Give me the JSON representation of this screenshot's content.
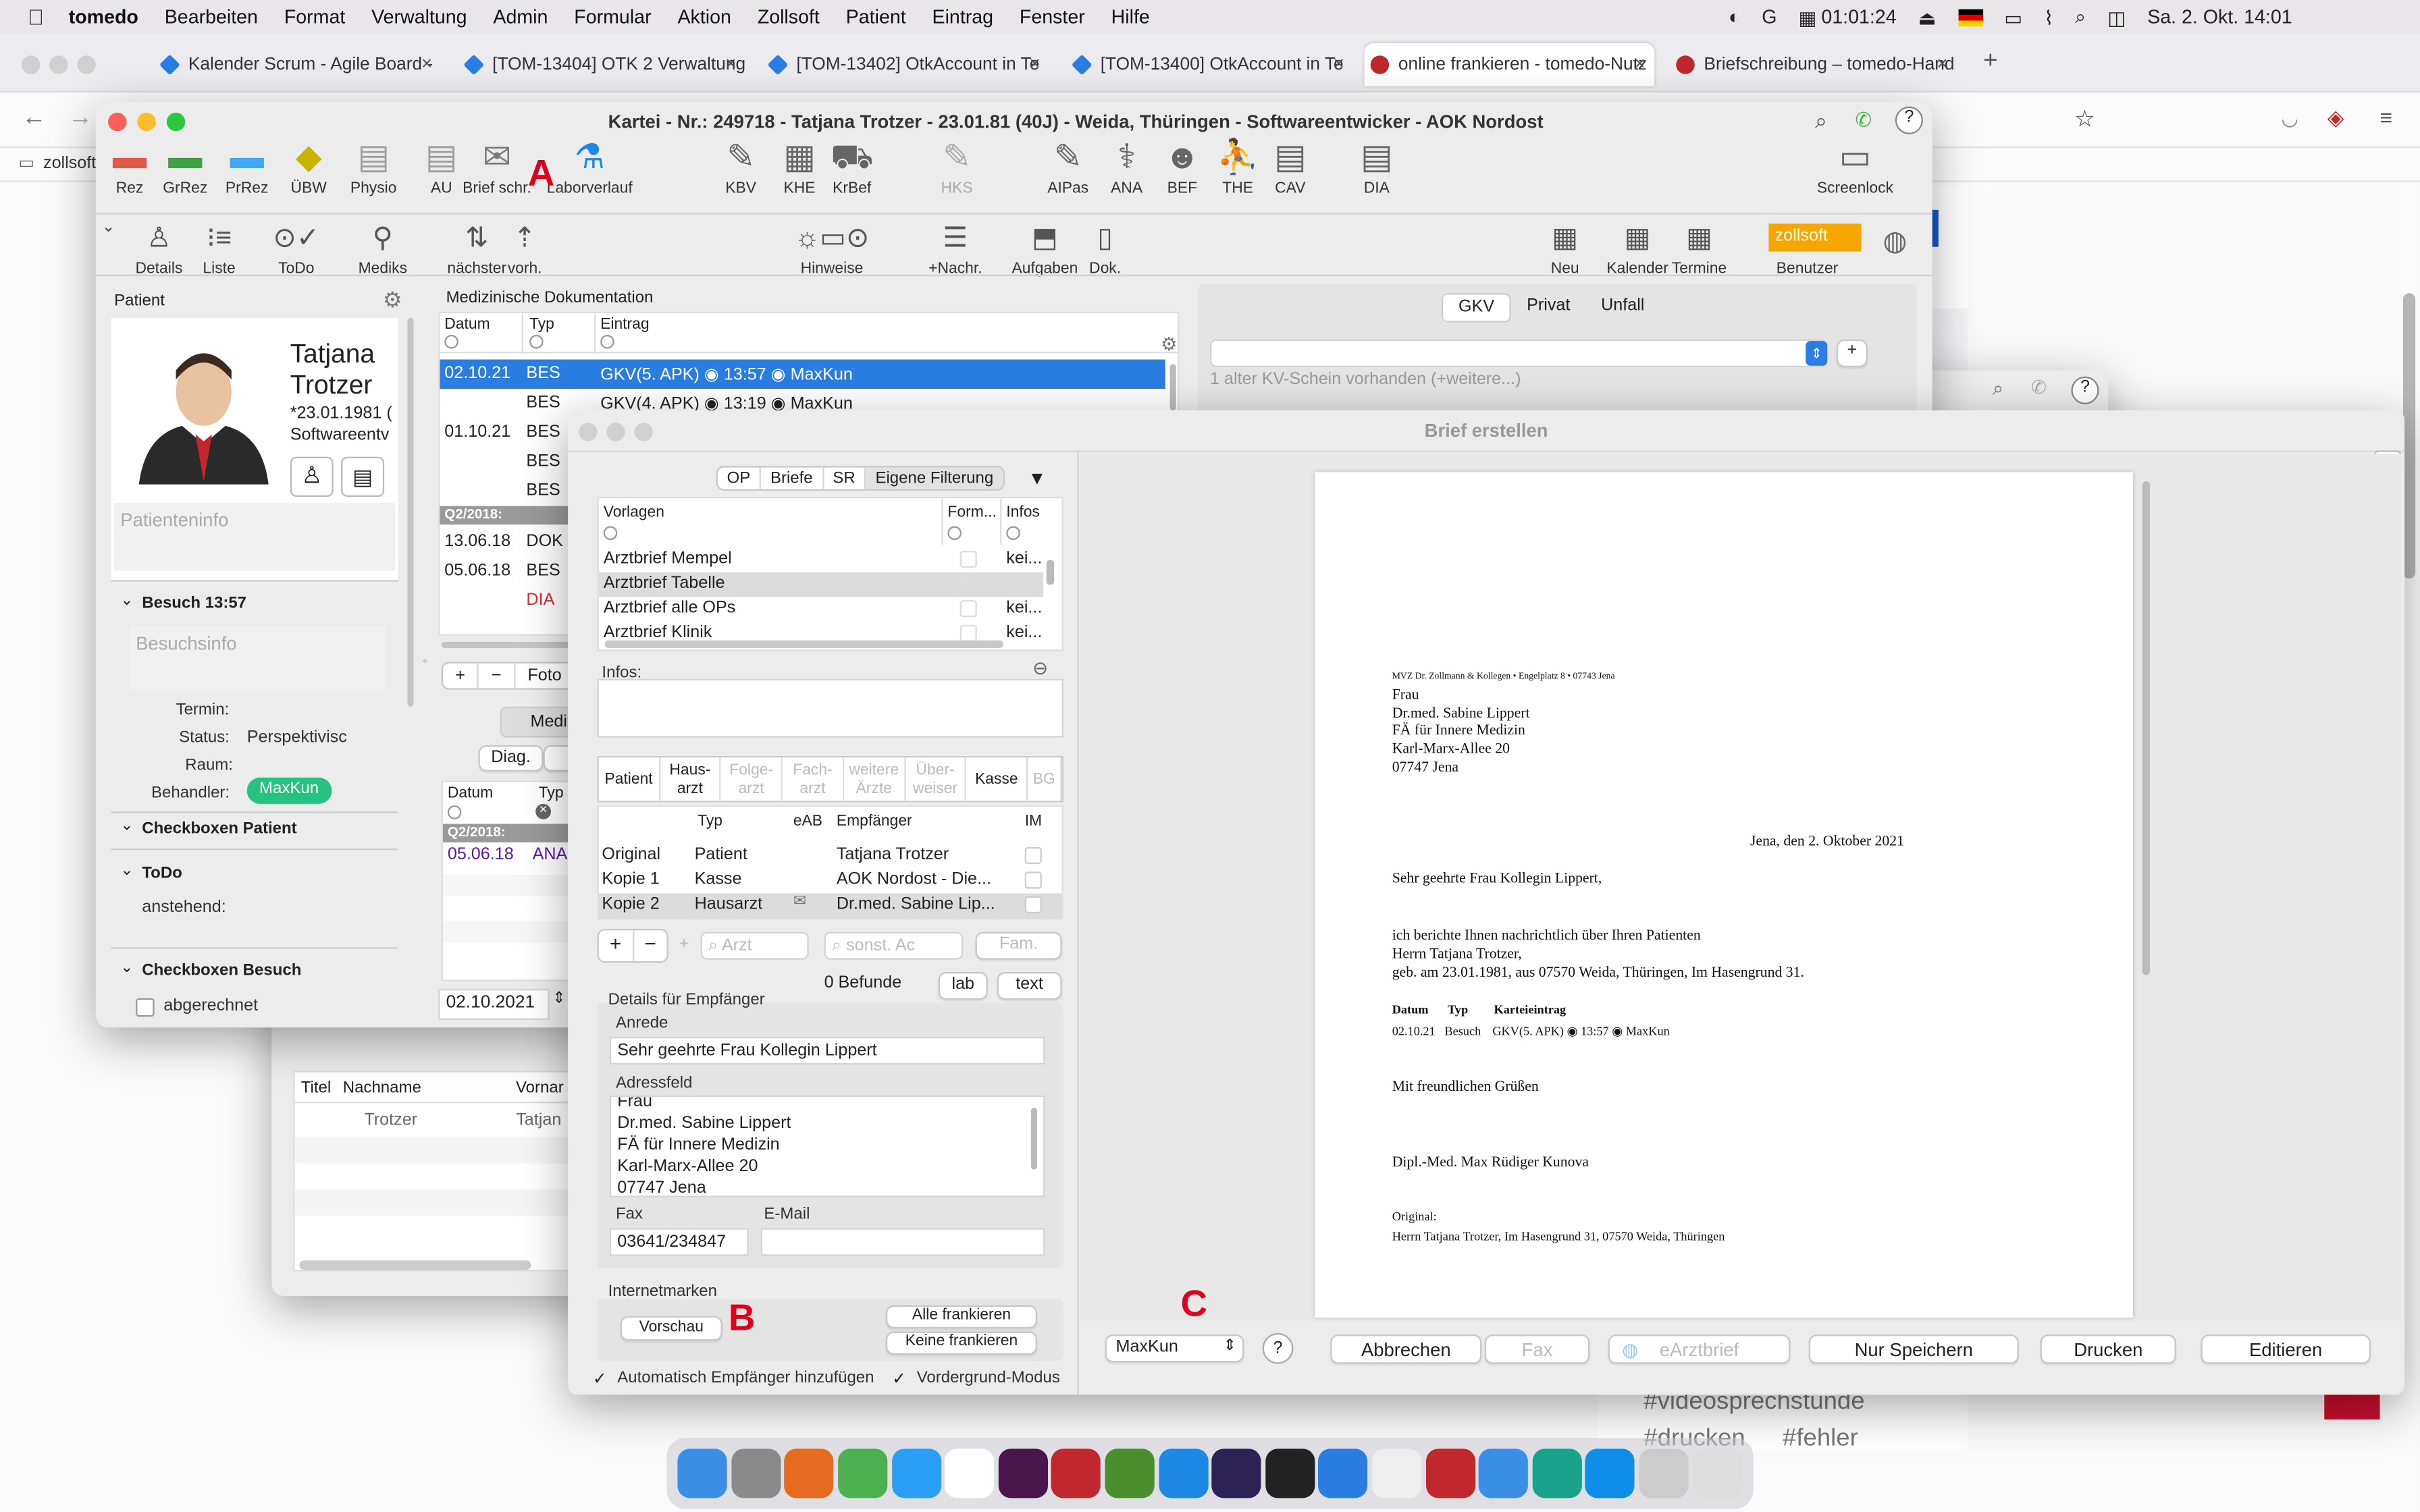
{
  "menubar": {
    "apple_icon": "apple-icon",
    "items": [
      "tomedo",
      "Bearbeiten",
      "Format",
      "Verwaltung",
      "Admin",
      "Formular",
      "Aktion",
      "Zollsoft",
      "Patient",
      "Eintrag",
      "Fenster",
      "Hilfe"
    ],
    "timer": "01:01:24",
    "datetime": "Sa. 2. Okt.  14:01"
  },
  "browser": {
    "tabs": [
      {
        "label": "Kalender Scrum - Agile Board -",
        "color": "#2a7de1"
      },
      {
        "label": "[TOM-13404] OTK 2 Verwaltung",
        "color": "#2a7de1"
      },
      {
        "label": "[TOM-13402] OtkAccount in Te",
        "color": "#2a7de1"
      },
      {
        "label": "[TOM-13400] OtkAccount in Te",
        "color": "#2a7de1"
      },
      {
        "label": "online frankieren - tomedo-Nutz",
        "color": "#c0282d"
      },
      {
        "label": "Briefschreibung – tomedo-Hand",
        "color": "#c0282d"
      }
    ],
    "bookmark": "zollsoft",
    "bg_tags": [
      "#videosprechstunde",
      "#drucken",
      "#fehler"
    ]
  },
  "kartei": {
    "title": "Kartei - Nr.: 249718 - Tatjana Trotzer - 23.01.81 (40J) - Weida, Thüringen - Softwareentwicker  - AOK Nordost",
    "toolbar1": [
      {
        "label": "Rez",
        "icon": "rez-icon",
        "color": "#e05a4a"
      },
      {
        "label": "GrRez",
        "icon": "grrez-icon",
        "color": "#43a047"
      },
      {
        "label": "PrRez",
        "icon": "prrez-icon",
        "color": "#42a5f5"
      },
      {
        "label": "ÜBW",
        "icon": "uebw-icon",
        "color": "#c8b400"
      },
      {
        "label": "Physio",
        "icon": "physio-icon",
        "color": "#9e9e9e"
      },
      {
        "label": "AU",
        "icon": "au-icon",
        "color": "#9e9e9e"
      },
      {
        "label": "Brief schr.",
        "icon": "letter-icon",
        "color": "#777"
      },
      {
        "label": "Laborverlauf",
        "icon": "lab-flask-icon",
        "color": "#1e88e5"
      },
      {
        "label": "KBV",
        "icon": "kbv-icon",
        "color": "#666"
      },
      {
        "label": "KHE",
        "icon": "hospital-icon",
        "color": "#666"
      },
      {
        "label": "KrBef",
        "icon": "ambulance-icon",
        "color": "#666"
      },
      {
        "label": "HKS",
        "icon": "hks-icon",
        "color": "#aaa"
      },
      {
        "label": "AIPas",
        "icon": "aipas-icon",
        "color": "#666"
      },
      {
        "label": "ANA",
        "icon": "stethoscope-icon",
        "color": "#666"
      },
      {
        "label": "BEF",
        "icon": "doctor-icon",
        "color": "#666"
      },
      {
        "label": "THE",
        "icon": "therapy-icon",
        "color": "#666"
      },
      {
        "label": "CAV",
        "icon": "cav-icon",
        "color": "#666"
      },
      {
        "label": "DIA",
        "icon": "dia-icon",
        "color": "#666"
      },
      {
        "label": "Screenlock",
        "icon": "screenlock-icon",
        "color": "#666"
      }
    ],
    "toolbar2": [
      {
        "label": "Details",
        "icon": "details-icon"
      },
      {
        "label": "Liste",
        "icon": "list-icon"
      },
      {
        "label": "ToDo",
        "icon": "todo-icon"
      },
      {
        "label": "Mediks",
        "icon": "pill-icon"
      },
      {
        "label": "nächster",
        "icon": "next-icon"
      },
      {
        "label": "vorh.",
        "icon": "prev-icon"
      },
      {
        "label": "Hinweise",
        "icon": "hints-icon"
      },
      {
        "label": "+Nachr.",
        "icon": "message-icon"
      },
      {
        "label": "Aufgaben",
        "icon": "tasks-icon"
      },
      {
        "label": "Dok.",
        "icon": "book-icon"
      },
      {
        "label": "Neu",
        "icon": "calendar-new-icon"
      },
      {
        "label": "Kalender",
        "icon": "calendar-icon"
      },
      {
        "label": "Termine",
        "icon": "appointments-icon"
      },
      {
        "label": "Benutzer",
        "icon": "user-badge-icon"
      }
    ],
    "benutzer_badge": "zollsoft",
    "patient": {
      "header": "Patient",
      "firstname": "Tatjana",
      "lastname": "Trotzer",
      "birth": "*23.01.1981 (",
      "job": "Softwareentv",
      "info_placeholder": "Patienteninfo",
      "visit_header": "Besuch 13:57",
      "visit_placeholder": "Besuchsinfo",
      "termin_label": "Termin:",
      "status_label": "Status:",
      "status_value": "Perspektivisc",
      "raum_label": "Raum:",
      "behandler_label": "Behandler:",
      "behandler_value": "MaxKun",
      "cb_patient": "Checkboxen Patient",
      "todo": "ToDo",
      "anstehend": "anstehend:",
      "cb_besuch": "Checkboxen Besuch",
      "abgerechnet": "abgerechnet"
    },
    "doku": {
      "title": "Medizinische Dokumentation",
      "headers": [
        "Datum",
        "Typ",
        "Eintrag"
      ],
      "rows": [
        {
          "date": "02.10.21",
          "typ": "BES",
          "entry": "GKV(5. APK) ◉ 13:57 ◉ MaxKun",
          "selected": true
        },
        {
          "date": "",
          "typ": "BES",
          "entry": "GKV(4. APK) ◉ 13:19 ◉ MaxKun"
        },
        {
          "date": "01.10.21",
          "typ": "BES",
          "entry": ""
        },
        {
          "date": "",
          "typ": "BES",
          "entry": ""
        },
        {
          "date": "",
          "typ": "BES",
          "entry": ""
        },
        {
          "group": "Q2/2018:"
        },
        {
          "date": "13.06.18",
          "typ": "DOK",
          "entry": ""
        },
        {
          "date": "05.06.18",
          "typ": "BES",
          "entry": ""
        },
        {
          "date": "",
          "typ": "DIA",
          "entry": "",
          "red": true
        }
      ],
      "foto_label": "Foto",
      "medik_label": "Medik",
      "diag_label": "Diag.",
      "med_headers": [
        "Datum",
        "Typ"
      ],
      "med_group": "Q2/2018:",
      "med_row_date": "05.06.18",
      "med_row_typ": "ANA",
      "date_field": "02.10.2021"
    },
    "kv": {
      "tabs": [
        "GKV",
        "Privat",
        "Unfall"
      ],
      "note": "1 alter KV-Schein vorhanden (+weitere...)"
    },
    "patlist": {
      "headers": [
        "Titel",
        "Nachname",
        "Vornar"
      ],
      "row": [
        "",
        "Trotzer",
        "Tatjan"
      ]
    }
  },
  "brief": {
    "title": "Brief erstellen",
    "filters": [
      "OP",
      "Briefe",
      "SR",
      "Eigene Filterung"
    ],
    "vorlagen_headers": [
      "Vorlagen",
      "Form...",
      "Infos"
    ],
    "vorlagen": [
      {
        "name": "Arztbrief Mempel",
        "info": "kei..."
      },
      {
        "name": "Arztbrief Tabelle",
        "info": "",
        "selected": true
      },
      {
        "name": "Arztbrief alle OPs",
        "info": "kei..."
      },
      {
        "name": "Arztbrief  Klinik",
        "info": "kei..."
      }
    ],
    "infos_label": "Infos:",
    "recip_tabs": [
      "Patient",
      "Haus-\narzt",
      "Folge-\narzt",
      "Fach-\narzt",
      "weitere\nÄrzte",
      "Über-\nweiser",
      "Kasse",
      "BG"
    ],
    "recip_headers": [
      "Typ",
      "eAB",
      "Empfänger",
      "IM"
    ],
    "recipients": [
      {
        "kind": "Original",
        "typ": "Patient",
        "empf": "Tatjana Trotzer"
      },
      {
        "kind": "Kopie 1",
        "typ": "Kasse",
        "empf": "AOK Nordost - Die..."
      },
      {
        "kind": "Kopie 2",
        "typ": "Hausarzt",
        "empf": "Dr.med. Sabine Lip...",
        "selected": true
      }
    ],
    "arzt_placeholder": "Arzt",
    "sonst_placeholder": "sonst. Ac",
    "fam_label": "Fam.",
    "befunde": "0 Befunde",
    "lab_btn": "lab",
    "text_btn": "text",
    "details_label": "Details für Empfänger",
    "anrede_label": "Anrede",
    "anrede_value": "Sehr geehrte Frau Kollegin Lippert",
    "adress_label": "Adressfeld",
    "adress_lines": [
      "Frau",
      "Dr.med. Sabine Lippert",
      "FÄ für Innere Medizin",
      "Karl-Marx-Allee 20",
      "07747 Jena"
    ],
    "fax_label": "Fax",
    "fax_value": "03641/234847",
    "email_label": "E-Mail",
    "internet_label": "Internetmarken",
    "vorschau_btn": "Vorschau",
    "alle_btn": "Alle frankieren",
    "keine_btn": "Keine frankieren",
    "auto_label": "Automatisch Empfänger hinzufügen",
    "vordergrund_label": "Vordergrund-Modus",
    "user_select": "MaxKun",
    "help": "?",
    "buttons": [
      "Abbrechen",
      "Fax",
      "eArztbrief",
      "Nur Speichern",
      "Drucken",
      "Editieren"
    ],
    "marker_a": "A",
    "marker_b": "B",
    "marker_c": "C",
    "doc": {
      "sender": "MVZ Dr. Zollmann & Kollegen • Engelplatz 8 • 07743 Jena",
      "addr": [
        "Frau",
        "Dr.med. Sabine Lippert",
        "FÄ für Innere Medizin",
        "Karl-Marx-Allee 20",
        "07747 Jena"
      ],
      "date": "Jena, den 2. Oktober 2021",
      "salutation": "Sehr geehrte Frau Kollegin Lippert,",
      "body": [
        "ich berichte Ihnen nachrichtlich über Ihren Patienten",
        "Herrn Tatjana Trotzer,",
        "geb. am 23.01.1981, aus 07570 Weida, Thüringen, Im Hasengrund 31."
      ],
      "table_headers": [
        "Datum",
        "Typ",
        "Karteieintrag"
      ],
      "table_row": [
        "02.10.21",
        "Besuch",
        "GKV(5. APK) ◉ 13:57 ◉ MaxKun"
      ],
      "closing": "Mit freundlichen Grüßen",
      "signer": "Dipl.-Med. Max Rüdiger Kunova",
      "orig_label": "Original:",
      "orig_addr": "Herrn Tatjana Trotzer, Im Hasengrund 31, 07570 Weida, Thüringen"
    }
  },
  "dock": [
    {
      "name": "finder-icon",
      "color": "#3a8ee6"
    },
    {
      "name": "system-prefs-icon",
      "color": "#8a8a8a"
    },
    {
      "name": "firefox-icon",
      "color": "#e66a1f"
    },
    {
      "name": "chrome-icon",
      "color": "#4caf50"
    },
    {
      "name": "safari-icon",
      "color": "#2a9df4"
    },
    {
      "name": "calendar-icon",
      "color": "#ffffff"
    },
    {
      "name": "slack-icon",
      "color": "#4a154b"
    },
    {
      "name": "tomedo-icon",
      "color": "#c0282d"
    },
    {
      "name": "tomedo-t-icon",
      "color": "#4b8e2e"
    },
    {
      "name": "maps-icon",
      "color": "#1e88e5"
    },
    {
      "name": "eclipse-icon",
      "color": "#2c2255"
    },
    {
      "name": "terminal-icon",
      "color": "#222"
    },
    {
      "name": "xcode-icon",
      "color": "#2a7de1"
    },
    {
      "name": "textedit-icon",
      "color": "#eee"
    },
    {
      "name": "tomedo-red-icon",
      "color": "#c0282d"
    },
    {
      "name": "mail-icon",
      "color": "#3a8ee6"
    },
    {
      "name": "e-icon",
      "color": "#1aa38a"
    },
    {
      "name": "teamviewer-icon",
      "color": "#0e8ee9"
    },
    {
      "name": "files-icon",
      "color": "#ccc"
    },
    {
      "name": "trash-icon",
      "color": "#ddd"
    }
  ]
}
